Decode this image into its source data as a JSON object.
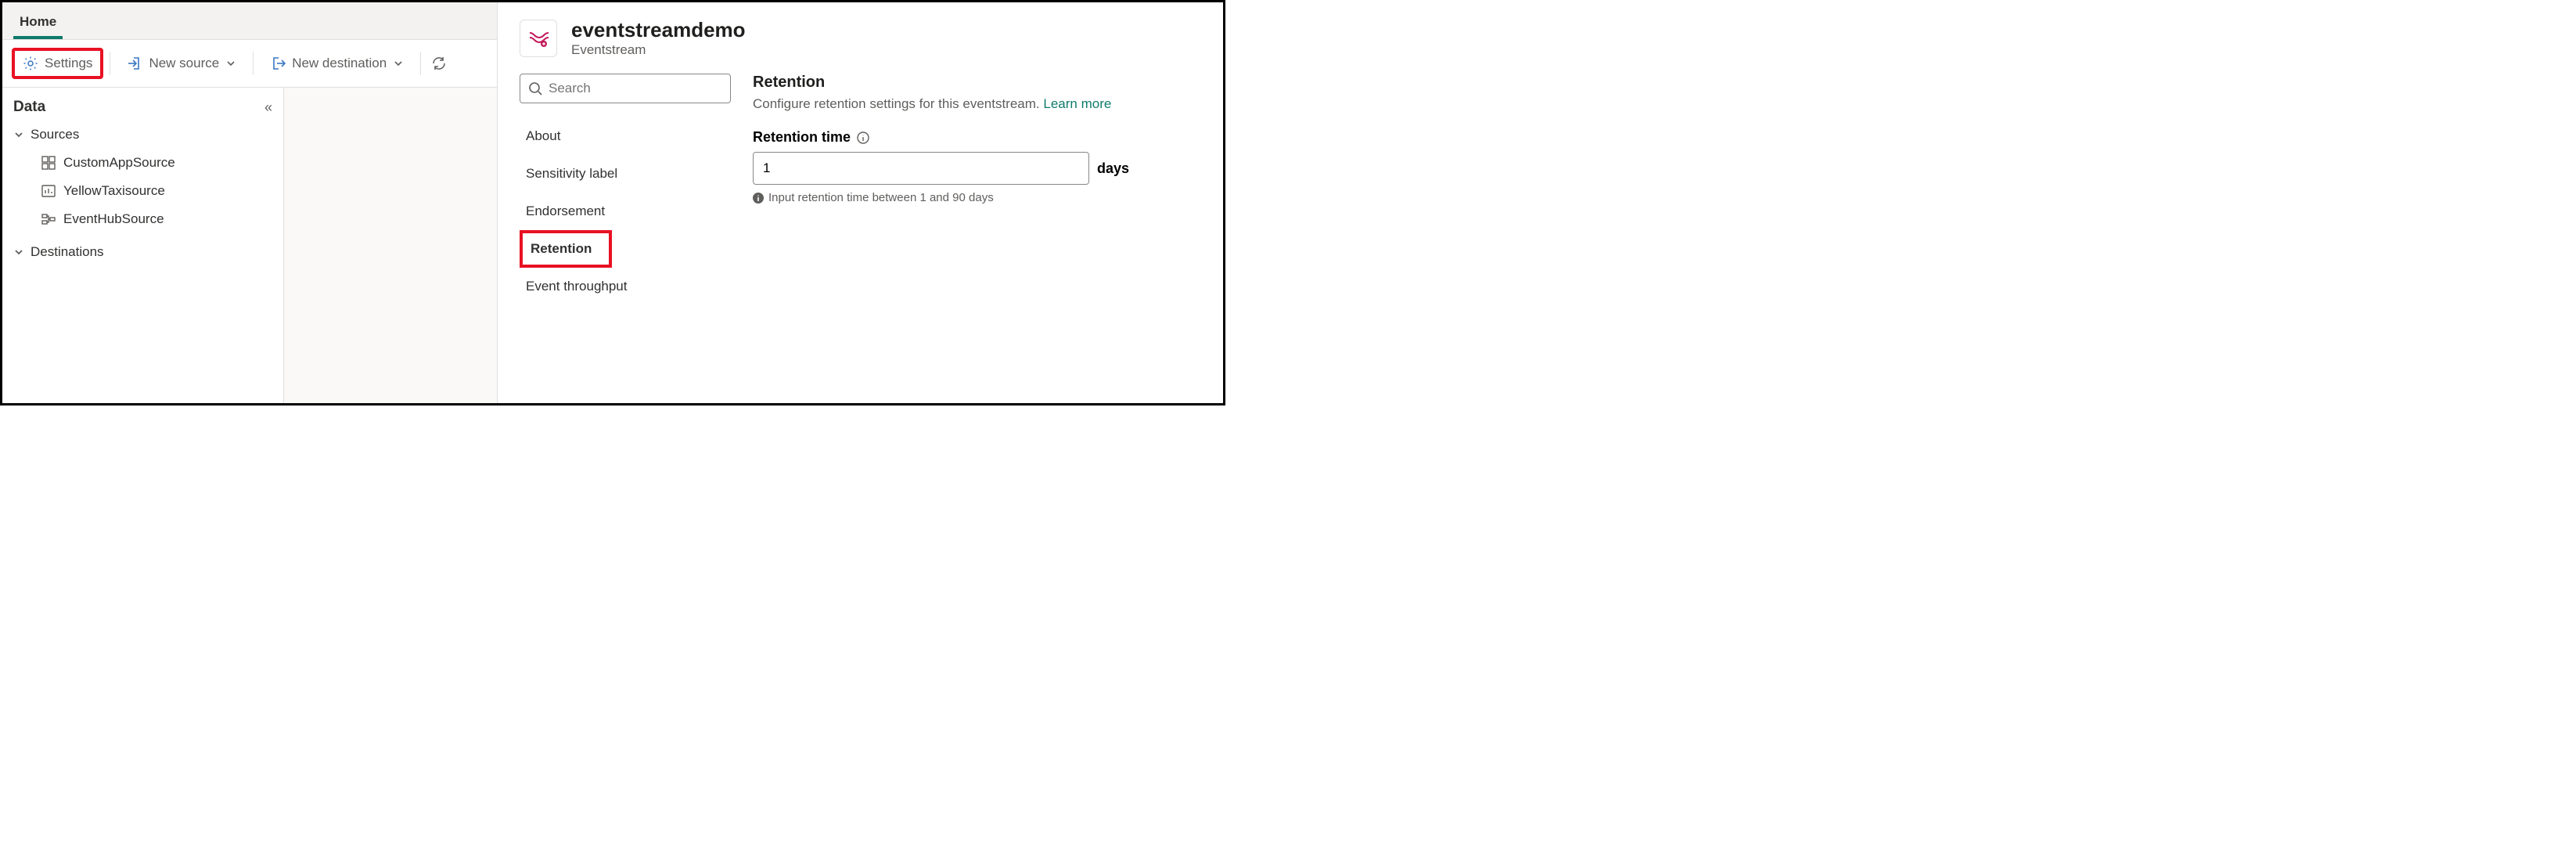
{
  "tabs": {
    "home": "Home"
  },
  "toolbar": {
    "settings": "Settings",
    "new_source": "New source",
    "new_destination": "New destination"
  },
  "data_panel": {
    "title": "Data",
    "sources_label": "Sources",
    "destinations_label": "Destinations",
    "sources": [
      {
        "label": "CustomAppSource",
        "icon": "app-icon"
      },
      {
        "label": "YellowTaxisource",
        "icon": "data-icon"
      },
      {
        "label": "EventHubSource",
        "icon": "hub-icon"
      }
    ]
  },
  "panel": {
    "title": "eventstreamdemo",
    "subtitle": "Eventstream",
    "search_placeholder": "Search",
    "nav": {
      "about": "About",
      "sensitivity": "Sensitivity label",
      "endorsement": "Endorsement",
      "retention": "Retention",
      "throughput": "Event throughput"
    },
    "retention": {
      "heading": "Retention",
      "desc": "Configure retention settings for this eventstream.",
      "learn_more": "Learn more",
      "field_label": "Retention time",
      "value": "1",
      "unit": "days",
      "hint": "Input retention time between 1 and 90 days"
    }
  }
}
